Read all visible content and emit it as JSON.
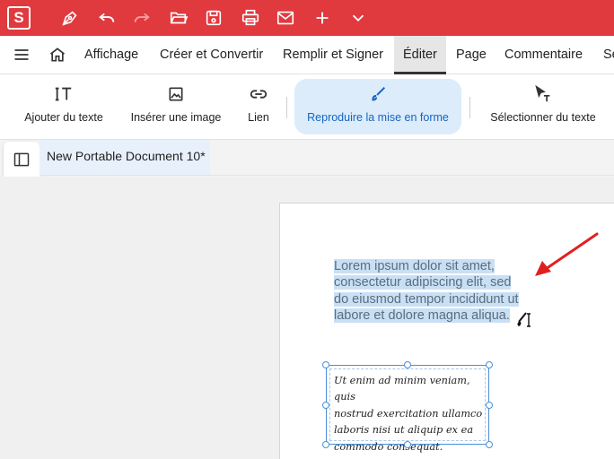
{
  "app": {
    "logo_letter": "S",
    "quick_access": [
      "pen-nib-icon",
      "undo-icon",
      "redo-icon",
      "open-folder-icon",
      "save-icon",
      "print-icon",
      "email-icon",
      "plus-icon",
      "chevron-down-icon"
    ]
  },
  "menu": {
    "items": [
      "Affichage",
      "Créer et Convertir",
      "Remplir et Signer",
      "Éditer",
      "Page",
      "Commentaire",
      "Se"
    ],
    "active": "Éditer"
  },
  "toolbar": {
    "add_text": "Ajouter du texte",
    "insert_image": "Insérer une image",
    "link": "Lien",
    "format_painter": "Reproduire la mise en forme",
    "select_text": "Sélectionner du texte"
  },
  "document": {
    "tab_title": "New Portable Document 10*"
  },
  "content": {
    "para1_lines": [
      "Lorem ipsum dolor sit amet,",
      "consectetur adipiscing elit, sed",
      "do eiusmod tempor incididunt ut",
      "labore et dolore magna aliqua."
    ],
    "para2_lines": [
      "Ut enim ad minim veniam, quis",
      "nostrud exercitation ullamco",
      "laboris nisi ut aliquip ex ea",
      "commodo consequat."
    ]
  },
  "colors": {
    "brand": "#e0393e",
    "active_tool_bg": "#dcecfb",
    "highlight": "#c9dff4",
    "annotation_arrow": "#e02020"
  }
}
